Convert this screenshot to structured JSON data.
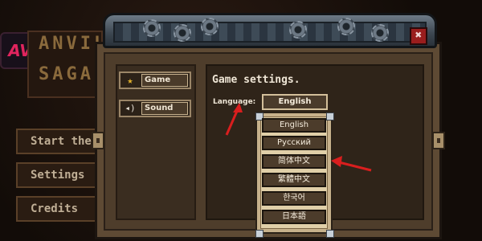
{
  "background": {
    "logo_text": "AV",
    "title_line1": "ANVIL",
    "title_line2": "SAGA",
    "menu": [
      "Start the g",
      "Settings",
      "Credits"
    ]
  },
  "dialog": {
    "close_icon": "✖",
    "tabs": [
      {
        "label": "Game",
        "icon": "star-icon",
        "glyph": "★",
        "selected": true
      },
      {
        "label": "Sound",
        "icon": "speaker-icon",
        "glyph": "◂)",
        "selected": false
      }
    ],
    "content": {
      "title": "Game settings.",
      "language_label": "Language:",
      "language_value": "English",
      "options": [
        "English",
        "Русский",
        "简体中文",
        "繁體中文",
        "한국어",
        "日本語"
      ]
    }
  },
  "annotation_colors": {
    "arrow": "#d91e1e"
  }
}
